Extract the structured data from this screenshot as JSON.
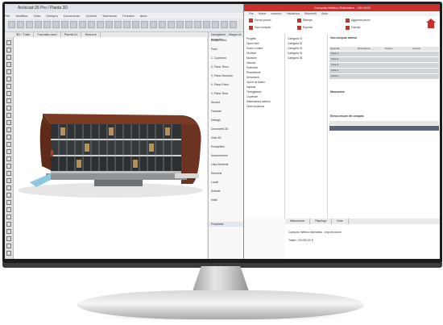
{
  "cad_app": {
    "title": "Archicad-26 Pro / Pianta 3D",
    "menu": [
      "File",
      "Modifica",
      "Vista",
      "Disegno",
      "Documento",
      "Opzioni",
      "Teamwork",
      "Finestra",
      "Aiuto"
    ],
    "tabs": [
      "3D / Tutto",
      "Facciata nord",
      "Pianta 01",
      "Sezione"
    ],
    "navigator": {
      "header": "Navigatore - Mappa di progetto",
      "items": [
        "Edificio Uffici",
        "Piani",
        "1. Copertura",
        "2. Piano Terzo",
        "3. Piano Secondo",
        "4. Piano Primo",
        "0. Piano Terra",
        "Sezioni",
        "Facciate",
        "Dettagli",
        "Documenti 3D",
        "Viste 3D",
        "Prospettive",
        "Assonometrie",
        "Lista Elementi",
        "Elementi",
        "Locali",
        "Schede",
        "Indici"
      ],
      "properties_header": "Proprietà"
    }
  },
  "doc_app": {
    "title": "Computo Metrico Estimativo - CM 2023",
    "ribbon_tabs": [
      "File",
      "Home",
      "Inserisci",
      "Visualizza",
      "Strumenti",
      "Aiuto"
    ],
    "ribbon": {
      "items": [
        "Elenco prezzi",
        "Voci computo",
        "Stampa",
        "Esporta",
        "Aggiorna prezzi",
        "Calcola"
      ]
    },
    "tree": {
      "items": [
        "Progetto",
        "Opere edili",
        "Scavi e rinterri",
        "Strutture",
        "Murature",
        "Intonaci",
        "Pavimenti",
        "Rivestimenti",
        "Serramenti",
        "Opere da fabbro",
        "Impianti",
        "Tinteggiature",
        "Coperture",
        "Sistemazioni esterne",
        "Oneri sicurezza"
      ]
    },
    "mid": {
      "items": [
        "Categoria 01",
        "Categoria 02",
        "Categoria 03",
        "Categoria 04",
        "Categoria 05"
      ]
    },
    "main": {
      "header": "Voci computo metrico",
      "columns": [
        "Quantità",
        "Descrizione",
        "Prezzo",
        "Importo"
      ],
      "rows": [
        "Voce 1",
        "Voce 2",
        "Voce 3",
        "Voce 4",
        "Voce 5"
      ],
      "section2": "Misurazioni",
      "section3": "Elenco misure del computo"
    },
    "bottom_tabs": [
      "Misurazione",
      "Riepilogo",
      "Note"
    ],
    "bottom_lines": [
      "Computo metrico estimativo - Importo lavori",
      "Totale: 100.000,00 €"
    ]
  }
}
